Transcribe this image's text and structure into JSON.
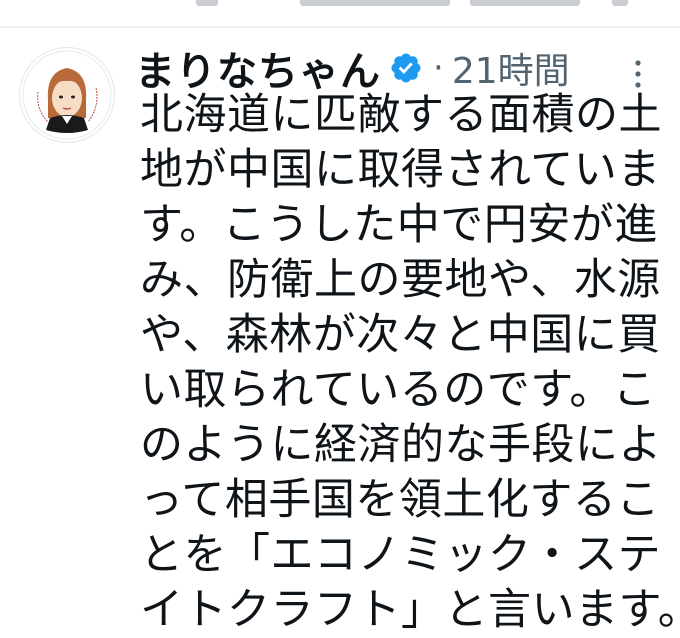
{
  "tweet": {
    "author_name": "まりなちゃん",
    "verified_icon": "verified-badge-icon",
    "separator": "·",
    "timestamp": "21時間",
    "more_icon": "more-vertical-icon",
    "body_lines": [
      "北海道に匹敵する面積の土",
      "地が中国に取得されていま",
      "す。こうした中で円安が進",
      "み、防衛上の要地や、水源",
      "や、森林が次々と中国に買",
      "い取られているのです。こ",
      "のように経済的な手段によ",
      "って相手国を領土化するこ",
      "とを「エコノミック・ステ",
      "イトクラフト」と言います。"
    ]
  },
  "colors": {
    "verified": "#1d9bf0",
    "secondary_text": "#536471",
    "primary_text": "#0f1419",
    "divider": "#eff3f4"
  }
}
